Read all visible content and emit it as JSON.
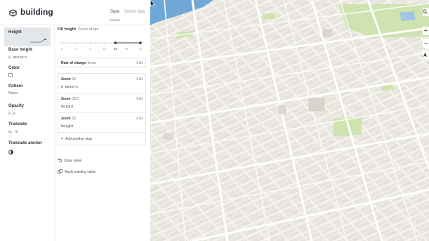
{
  "header": {
    "layer_name": "building",
    "tabs": [
      {
        "label": "Style",
        "active": true
      },
      {
        "label": "Select data",
        "active": false
      }
    ]
  },
  "properties": [
    {
      "label": "Height",
      "value": "",
      "selected": true
    },
    {
      "label": "Base height",
      "value": "0 meters"
    },
    {
      "label": "Color",
      "value": ""
    },
    {
      "label": "Pattern",
      "value": "None"
    },
    {
      "label": "Opacity",
      "value": "0.6"
    },
    {
      "label": "Translate",
      "value": "0, 0"
    },
    {
      "label": "Translate anchor",
      "value": ""
    }
  ],
  "editor": {
    "fill_title": "Fill height",
    "fill_subtitle": "Zoom range",
    "slider": {
      "ticks": [
        "0",
        "4",
        "8",
        "12",
        "15",
        "18",
        "22"
      ],
      "handles": [
        15,
        22
      ],
      "selected_label": "15"
    },
    "rate_of_change": {
      "label": "Rate of change",
      "value": "linear",
      "edit": "Edit"
    },
    "stops": [
      {
        "zoom_label": "Zoom",
        "zoom": "15",
        "value": "0 meters",
        "edit": "Edit"
      },
      {
        "zoom_label": "Zoom",
        "zoom": "15.1",
        "value": "height",
        "edit": "Edit"
      },
      {
        "zoom_label": "Zoom",
        "zoom": "22",
        "value": "height",
        "edit": "Edit"
      }
    ],
    "add_stop": "Add another stop",
    "clear_value": "Clear value",
    "apply_existing": "Apply existing value"
  },
  "map": {
    "controls": [
      "search-icon",
      "zoom-in-icon",
      "zoom-out-icon",
      "compass-icon"
    ],
    "colors": {
      "land": "#f1efe9",
      "park": "#cfe3b0",
      "water": "#6fa8d6",
      "road": "#ffffff",
      "building": "#e9e6df"
    }
  }
}
